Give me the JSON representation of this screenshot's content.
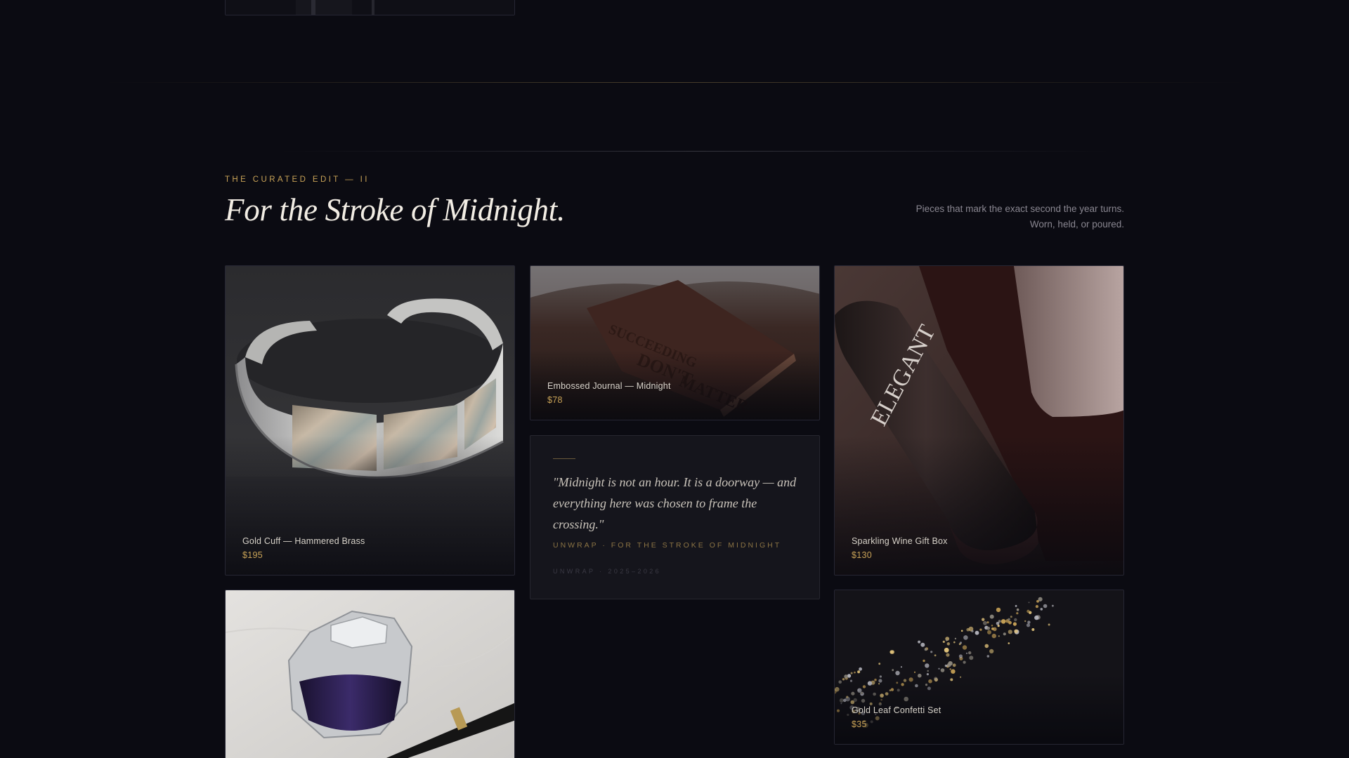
{
  "section": {
    "eyebrow": "THE CURATED EDIT — II",
    "title": "For the Stroke of Midnight.",
    "intro_line_1": "Pieces that mark the exact second the year turns.",
    "intro_line_2": "Worn, held, or poured."
  },
  "products": [
    {
      "name": "Gold Cuff — Hammered Brass",
      "price": "$195"
    },
    {
      "name": "Embossed Journal — Midnight",
      "price": "$78"
    },
    {
      "name": "Sparkling Wine Gift Box",
      "price": "$130"
    },
    {
      "name": "Gold Leaf Confetti Set",
      "price": "$35"
    }
  ],
  "quote": {
    "text": "\"Midnight is not an hour. It is a doorway — and everything here was chosen to frame the crossing.\"",
    "tag": "UNWRAP · FOR THE STROKE OF MIDNIGHT",
    "footer": "UNWRAP · 2025–2026"
  },
  "images": {
    "bracelet": "photo of silver cuff bracelet with abalone inlays",
    "journal": "photo of embossed leather journal",
    "bottle": "photo of dark bottle in gift box",
    "confetti": "photo of gold and silver star confetti",
    "inkwell": "photo of glass inkwell with fountain pen",
    "top": "photo"
  },
  "colors": {
    "accent": "#c9a357",
    "background": "#0b0b12",
    "heading": "#f2ede4"
  }
}
